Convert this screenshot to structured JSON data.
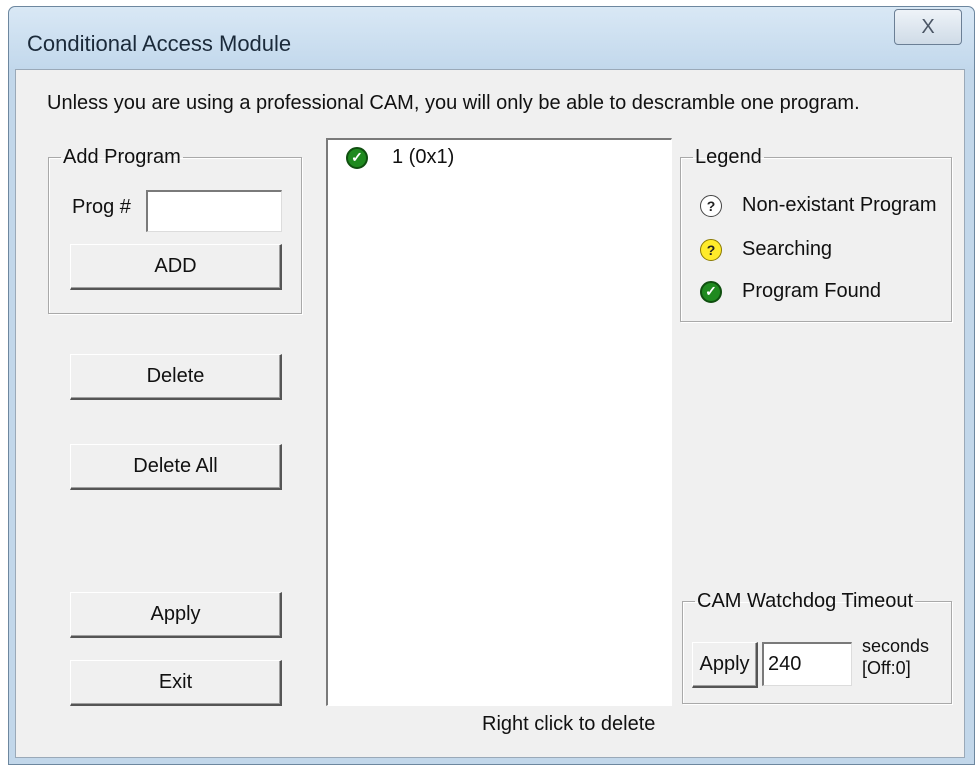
{
  "window": {
    "title": "Conditional Access Module",
    "close_label": "X"
  },
  "info_text": "Unless you are using a professional CAM, you will only be able to descramble one program.",
  "add_program": {
    "group_label": "Add Program",
    "prog_label": "Prog #",
    "prog_value": "",
    "add_label": "ADD"
  },
  "buttons": {
    "delete": "Delete",
    "delete_all": "Delete All",
    "apply": "Apply",
    "exit": "Exit"
  },
  "program_list": {
    "items": [
      {
        "label": "1 (0x1)",
        "status": "found"
      }
    ]
  },
  "right_click_hint": "Right click to delete",
  "legend": {
    "group_label": "Legend",
    "items": [
      {
        "label": "Non-existant Program",
        "icon": "question-circle-icon"
      },
      {
        "label": "Searching",
        "icon": "yellow-question-icon"
      },
      {
        "label": "Program Found",
        "icon": "green-check-icon"
      }
    ]
  },
  "watchdog": {
    "group_label": "CAM Watchdog Timeout",
    "apply_label": "Apply",
    "value": "240",
    "units_line1": "seconds",
    "units_line2": "[Off:0]"
  },
  "colors": {
    "found": "#1f8a1f",
    "searching": "#ffeb2a",
    "window_frame": "#c2d7ea"
  }
}
